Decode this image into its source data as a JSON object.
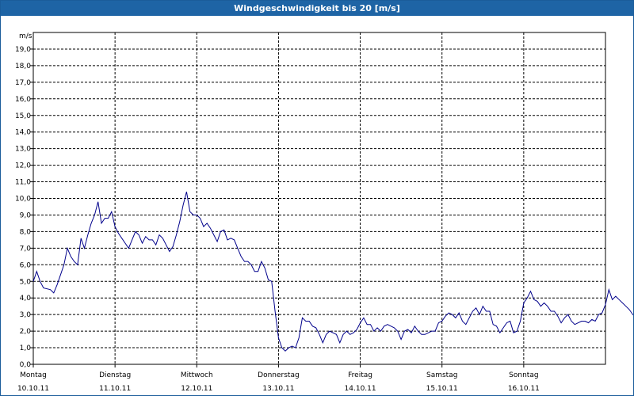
{
  "window": {
    "title": "Windgeschwindigkeit bis 20 [m/s]"
  },
  "chart_data": {
    "type": "line",
    "title": "Windgeschwindigkeit bis 20 [m/s]",
    "ylabel": "m/s",
    "ylim": [
      0,
      20
    ],
    "y_ticks": [
      "0,0",
      "1,0",
      "2,0",
      "3,0",
      "4,0",
      "5,0",
      "6,0",
      "7,0",
      "8,0",
      "9,0",
      "10,0",
      "11,0",
      "12,0",
      "13,0",
      "14,0",
      "15,0",
      "16,0",
      "17,0",
      "18,0",
      "19,0"
    ],
    "x_ticks": [
      {
        "day": "Montag",
        "date": "10.10.11"
      },
      {
        "day": "Dienstag",
        "date": "11.10.11"
      },
      {
        "day": "Mittwoch",
        "date": "12.10.11"
      },
      {
        "day": "Donnerstag",
        "date": "13.10.11"
      },
      {
        "day": "Freitag",
        "date": "14.10.11"
      },
      {
        "day": "Samstag",
        "date": "15.10.11"
      },
      {
        "day": "Sonntag",
        "date": "16.10.11"
      }
    ],
    "x_unit": "hours since 10.10.11 00:00",
    "xlim": [
      0,
      168
    ],
    "grid": true,
    "line_color": "#00008b",
    "series": [
      {
        "values": [
          [
            0,
            5.0
          ],
          [
            1,
            5.6
          ],
          [
            2,
            5.0
          ],
          [
            3,
            4.6
          ],
          [
            5,
            4.5
          ],
          [
            6,
            4.3
          ],
          [
            7,
            4.8
          ],
          [
            8,
            5.4
          ],
          [
            9,
            6.0
          ],
          [
            10,
            7.0
          ],
          [
            11,
            6.5
          ],
          [
            12,
            6.2
          ],
          [
            13,
            6.0
          ],
          [
            14,
            7.6
          ],
          [
            15,
            7.0
          ],
          [
            16,
            7.8
          ],
          [
            17,
            8.5
          ],
          [
            18,
            9.0
          ],
          [
            19,
            9.8
          ],
          [
            20,
            8.5
          ],
          [
            21,
            8.8
          ],
          [
            22,
            8.8
          ],
          [
            23,
            9.2
          ],
          [
            24,
            8.3
          ],
          [
            25,
            7.9
          ],
          [
            26,
            7.6
          ],
          [
            27,
            7.3
          ],
          [
            28,
            7.0
          ],
          [
            29,
            7.5
          ],
          [
            30,
            8.0
          ],
          [
            31,
            7.8
          ],
          [
            32,
            7.3
          ],
          [
            33,
            7.7
          ],
          [
            34,
            7.5
          ],
          [
            35,
            7.5
          ],
          [
            36,
            7.2
          ],
          [
            37,
            7.8
          ],
          [
            38,
            7.6
          ],
          [
            39,
            7.2
          ],
          [
            40,
            6.8
          ],
          [
            41,
            7.1
          ],
          [
            42,
            7.8
          ],
          [
            43,
            8.6
          ],
          [
            44,
            9.6
          ],
          [
            45,
            10.4
          ],
          [
            46,
            9.2
          ],
          [
            47,
            9.0
          ],
          [
            48,
            9.0
          ],
          [
            49,
            8.8
          ],
          [
            50,
            8.3
          ],
          [
            51,
            8.5
          ],
          [
            52,
            8.2
          ],
          [
            53,
            7.8
          ],
          [
            54,
            7.4
          ],
          [
            55,
            8.0
          ],
          [
            56,
            8.1
          ],
          [
            57,
            7.5
          ],
          [
            58,
            7.6
          ],
          [
            59,
            7.5
          ],
          [
            60,
            7.0
          ],
          [
            61,
            6.5
          ],
          [
            62,
            6.2
          ],
          [
            63,
            6.2
          ],
          [
            64,
            6.0
          ],
          [
            65,
            5.6
          ],
          [
            66,
            5.6
          ],
          [
            67,
            6.2
          ],
          [
            68,
            5.8
          ],
          [
            69,
            5.1
          ],
          [
            70,
            5.0
          ],
          [
            71,
            3.2
          ],
          [
            72,
            1.6
          ],
          [
            73,
            1.0
          ],
          [
            74,
            0.8
          ],
          [
            75,
            1.0
          ],
          [
            76,
            1.1
          ],
          [
            77,
            1.0
          ],
          [
            78,
            1.6
          ],
          [
            79,
            2.8
          ],
          [
            80,
            2.6
          ],
          [
            81,
            2.6
          ],
          [
            82,
            2.3
          ],
          [
            83,
            2.2
          ],
          [
            84,
            1.8
          ],
          [
            85,
            1.3
          ],
          [
            86,
            1.8
          ],
          [
            87,
            2.0
          ],
          [
            88,
            1.9
          ],
          [
            89,
            1.8
          ],
          [
            90,
            1.3
          ],
          [
            91,
            1.8
          ],
          [
            92,
            2.0
          ],
          [
            93,
            1.8
          ],
          [
            94,
            1.9
          ],
          [
            95,
            2.1
          ],
          [
            96,
            2.5
          ],
          [
            97,
            2.8
          ],
          [
            98,
            2.4
          ],
          [
            99,
            2.4
          ],
          [
            100,
            2.0
          ],
          [
            101,
            2.2
          ],
          [
            102,
            2.0
          ],
          [
            103,
            2.3
          ],
          [
            104,
            2.4
          ],
          [
            105,
            2.3
          ],
          [
            106,
            2.2
          ],
          [
            107,
            2.0
          ],
          [
            108,
            1.5
          ],
          [
            109,
            2.0
          ],
          [
            110,
            2.1
          ],
          [
            111,
            1.9
          ],
          [
            112,
            2.3
          ],
          [
            113,
            2.0
          ],
          [
            114,
            1.8
          ],
          [
            115,
            1.8
          ],
          [
            116,
            1.9
          ],
          [
            117,
            2.0
          ],
          [
            118,
            2.0
          ],
          [
            119,
            2.5
          ],
          [
            120,
            2.6
          ],
          [
            121,
            2.9
          ],
          [
            122,
            3.1
          ],
          [
            123,
            3.0
          ],
          [
            124,
            2.8
          ],
          [
            125,
            3.1
          ],
          [
            126,
            2.6
          ],
          [
            127,
            2.4
          ],
          [
            128,
            2.8
          ],
          [
            129,
            3.2
          ],
          [
            130,
            3.4
          ],
          [
            131,
            3.0
          ],
          [
            132,
            3.5
          ],
          [
            133,
            3.2
          ],
          [
            134,
            3.2
          ],
          [
            135,
            2.4
          ],
          [
            136,
            2.3
          ],
          [
            137,
            1.9
          ],
          [
            138,
            2.2
          ],
          [
            139,
            2.5
          ],
          [
            140,
            2.6
          ],
          [
            141,
            1.9
          ],
          [
            142,
            2.0
          ],
          [
            143,
            2.6
          ],
          [
            144,
            3.7
          ],
          [
            145,
            4.0
          ],
          [
            146,
            4.4
          ],
          [
            147,
            3.9
          ],
          [
            148,
            3.8
          ],
          [
            149,
            3.5
          ],
          [
            150,
            3.7
          ],
          [
            151,
            3.5
          ],
          [
            152,
            3.2
          ],
          [
            153,
            3.2
          ],
          [
            154,
            2.9
          ],
          [
            155,
            2.5
          ],
          [
            156,
            2.8
          ],
          [
            157,
            3.0
          ],
          [
            158,
            2.6
          ],
          [
            159,
            2.4
          ],
          [
            160,
            2.5
          ],
          [
            161,
            2.6
          ],
          [
            162,
            2.6
          ],
          [
            163,
            2.5
          ],
          [
            164,
            2.7
          ],
          [
            165,
            2.6
          ],
          [
            166,
            3.0
          ],
          [
            167,
            3.1
          ],
          [
            168,
            3.6
          ],
          [
            169,
            4.5
          ],
          [
            170,
            3.9
          ],
          [
            171,
            4.1
          ],
          [
            172,
            3.9
          ],
          [
            173,
            3.7
          ],
          [
            174,
            3.5
          ],
          [
            175,
            3.3
          ],
          [
            176,
            3.0
          ],
          [
            177,
            2.8
          ],
          [
            178,
            2.7
          ],
          [
            179,
            2.6
          ],
          [
            180,
            2.7
          ],
          [
            181,
            3.4
          ],
          [
            182,
            2.6
          ]
        ]
      }
    ]
  }
}
